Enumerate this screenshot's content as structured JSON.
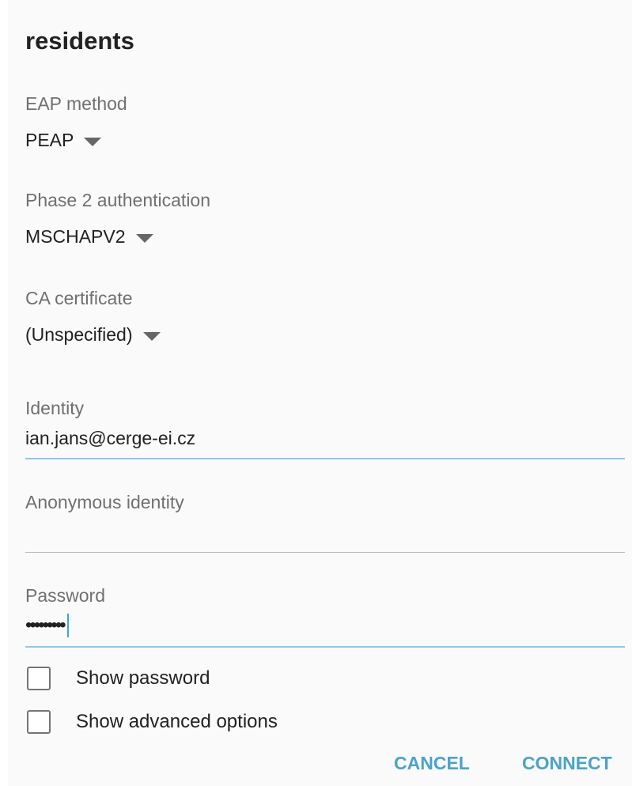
{
  "dialog": {
    "title": "residents"
  },
  "eap_method": {
    "label": "EAP method",
    "value": "PEAP"
  },
  "phase2": {
    "label": "Phase 2 authentication",
    "value": "MSCHAPV2"
  },
  "ca_certificate": {
    "label": "CA certificate",
    "value": "(Unspecified)"
  },
  "identity": {
    "label": "Identity",
    "value": "ian.jans@cerge-ei.cz"
  },
  "anonymous_identity": {
    "label": "Anonymous identity",
    "value": ""
  },
  "password": {
    "label": "Password",
    "masked_value": "•••••••••"
  },
  "options": {
    "show_password": "Show password",
    "show_advanced": "Show advanced options"
  },
  "buttons": {
    "cancel": "CANCEL",
    "connect": "CONNECT"
  },
  "colors": {
    "accent": "#4ba3c7",
    "focus_underline": "#8ec9e3",
    "label_gray": "#707070"
  }
}
